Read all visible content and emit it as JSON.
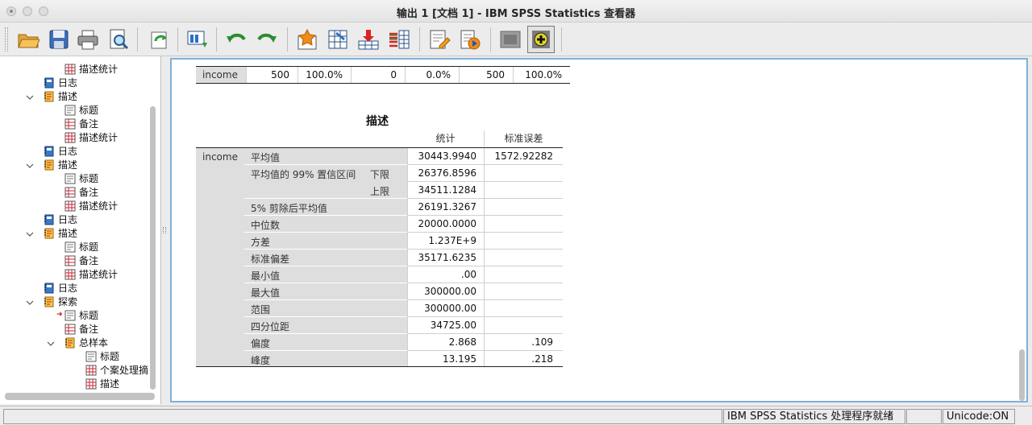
{
  "window": {
    "title": "输出 1 [文档 1] - IBM SPSS Statistics 查看器"
  },
  "toolbar": {
    "buttons": [
      "open-icon",
      "save-icon",
      "print-icon",
      "print-preview-icon",
      "export-icon",
      "recall-dialog-icon",
      "undo-icon",
      "redo-icon",
      "goto-case-icon",
      "goto-variable-icon",
      "insert-cases-icon",
      "select-cases-icon",
      "designate-window-icon",
      "run-script-icon",
      "show-hide-icon",
      "promote-icon"
    ]
  },
  "outline": {
    "items": [
      {
        "label": "描述统计",
        "icon": "table-icon"
      },
      {
        "label": "日志",
        "icon": "log-icon"
      },
      {
        "label": "描述",
        "icon": "folder-book-icon"
      },
      {
        "label": "标题",
        "icon": "title-icon"
      },
      {
        "label": "备注",
        "icon": "notes-icon"
      },
      {
        "label": "描述统计",
        "icon": "table-icon"
      },
      {
        "label": "日志",
        "icon": "log-icon"
      },
      {
        "label": "描述",
        "icon": "folder-book-icon"
      },
      {
        "label": "标题",
        "icon": "title-icon"
      },
      {
        "label": "备注",
        "icon": "notes-icon"
      },
      {
        "label": "描述统计",
        "icon": "table-icon"
      },
      {
        "label": "日志",
        "icon": "log-icon"
      },
      {
        "label": "描述",
        "icon": "folder-book-icon"
      },
      {
        "label": "标题",
        "icon": "title-icon"
      },
      {
        "label": "备注",
        "icon": "notes-icon"
      },
      {
        "label": "描述统计",
        "icon": "table-icon"
      },
      {
        "label": "日志",
        "icon": "log-icon"
      },
      {
        "label": "探索",
        "icon": "folder-book-icon"
      },
      {
        "label": "标题",
        "icon": "title-icon"
      },
      {
        "label": "备注",
        "icon": "notes-icon"
      },
      {
        "label": "总样本",
        "icon": "folder-book-icon"
      },
      {
        "label": "标题",
        "icon": "title-icon"
      },
      {
        "label": "个案处理摘",
        "icon": "table-icon"
      },
      {
        "label": "描述",
        "icon": "table-icon"
      }
    ]
  },
  "summary_row": {
    "label": "income",
    "values": [
      "500",
      "100.0%",
      "0",
      "0.0%",
      "500",
      "100.0%"
    ]
  },
  "descriptives": {
    "title": "描述",
    "col_stat": "统计",
    "col_se": "标准误差",
    "variable": "income",
    "rows": [
      {
        "name": "平均值",
        "sub": "",
        "stat": "30443.9940",
        "se": "1572.92282"
      },
      {
        "name": "平均值的 99% 置信区间",
        "sub": "下限",
        "stat": "26376.8596",
        "se": ""
      },
      {
        "name": "",
        "sub": "上限",
        "stat": "34511.1284",
        "se": ""
      },
      {
        "name": "5% 剪除后平均值",
        "sub": "",
        "stat": "26191.3267",
        "se": ""
      },
      {
        "name": "中位数",
        "sub": "",
        "stat": "20000.0000",
        "se": ""
      },
      {
        "name": "方差",
        "sub": "",
        "stat": "1.237E+9",
        "se": ""
      },
      {
        "name": "标准偏差",
        "sub": "",
        "stat": "35171.6235",
        "se": ""
      },
      {
        "name": "最小值",
        "sub": "",
        "stat": ".00",
        "se": ""
      },
      {
        "name": "最大值",
        "sub": "",
        "stat": "300000.00",
        "se": ""
      },
      {
        "name": "范围",
        "sub": "",
        "stat": "300000.00",
        "se": ""
      },
      {
        "name": "四分位距",
        "sub": "",
        "stat": "34725.00",
        "se": ""
      },
      {
        "name": "偏度",
        "sub": "",
        "stat": "2.868",
        "se": ".109"
      },
      {
        "name": "峰度",
        "sub": "",
        "stat": "13.195",
        "se": ".218"
      }
    ]
  },
  "status": {
    "processor": "IBM SPSS Statistics 处理程序就绪",
    "unicode": "Unicode:ON"
  }
}
